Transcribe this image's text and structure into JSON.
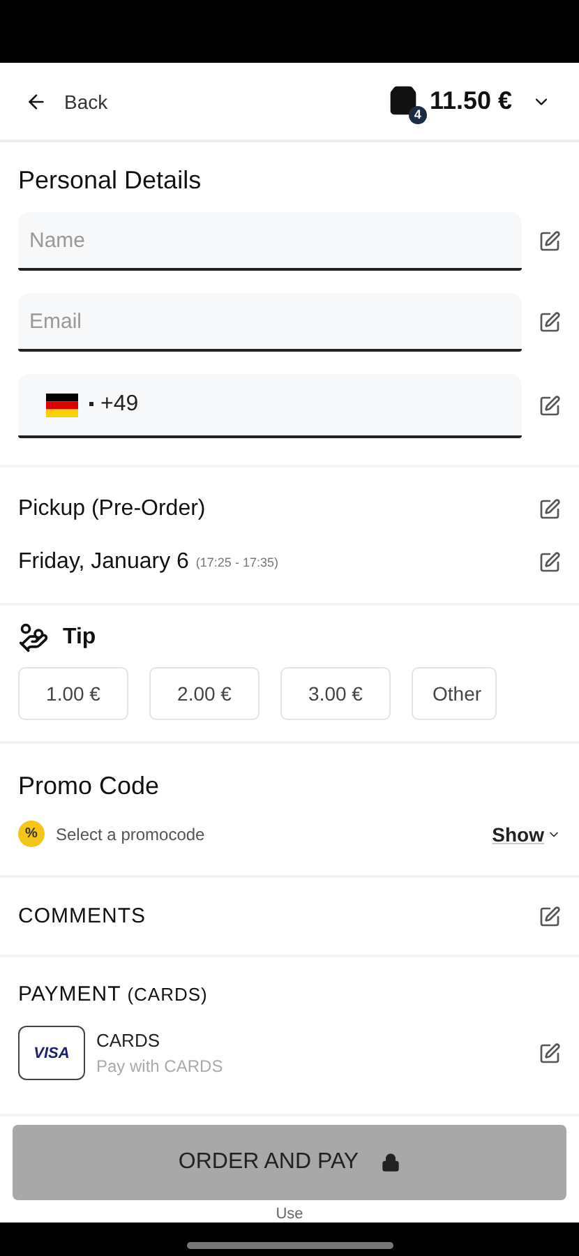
{
  "header": {
    "back_label": "Back",
    "cart_count": "4",
    "total": "11.50 €"
  },
  "personal_details": {
    "title": "Personal Details",
    "fields": [
      {
        "kind": "text",
        "placeholder": "Name"
      },
      {
        "kind": "text",
        "placeholder": "Email"
      },
      {
        "kind": "phone",
        "value": "+49"
      }
    ]
  },
  "pickup": {
    "title": "Pickup (Pre-Order)",
    "date": "Friday, January 6",
    "time": "(17:25 - 17:35)"
  },
  "tip": {
    "title": "Tip",
    "options": [
      {
        "label": "1.00 €",
        "selected": false
      },
      {
        "label": "2.00 €",
        "selected": false
      },
      {
        "label": "3.00 €",
        "selected": false
      },
      {
        "label": "Other",
        "selected": false
      }
    ]
  },
  "promo": {
    "title": "Promo Code",
    "badge": "%",
    "hint": "Select a promocode",
    "toggle": "Show"
  },
  "comments": {
    "title": "COMMENTS"
  },
  "payment": {
    "title": "PAYMENT",
    "title_suffix": "(CARDS)",
    "method": {
      "logo": "VISA",
      "name": "CARDS",
      "description": "Pay with CARDS"
    }
  },
  "order_button": {
    "label": "ORDER AND PAY",
    "disabled": true
  },
  "footer_note": "Use"
}
